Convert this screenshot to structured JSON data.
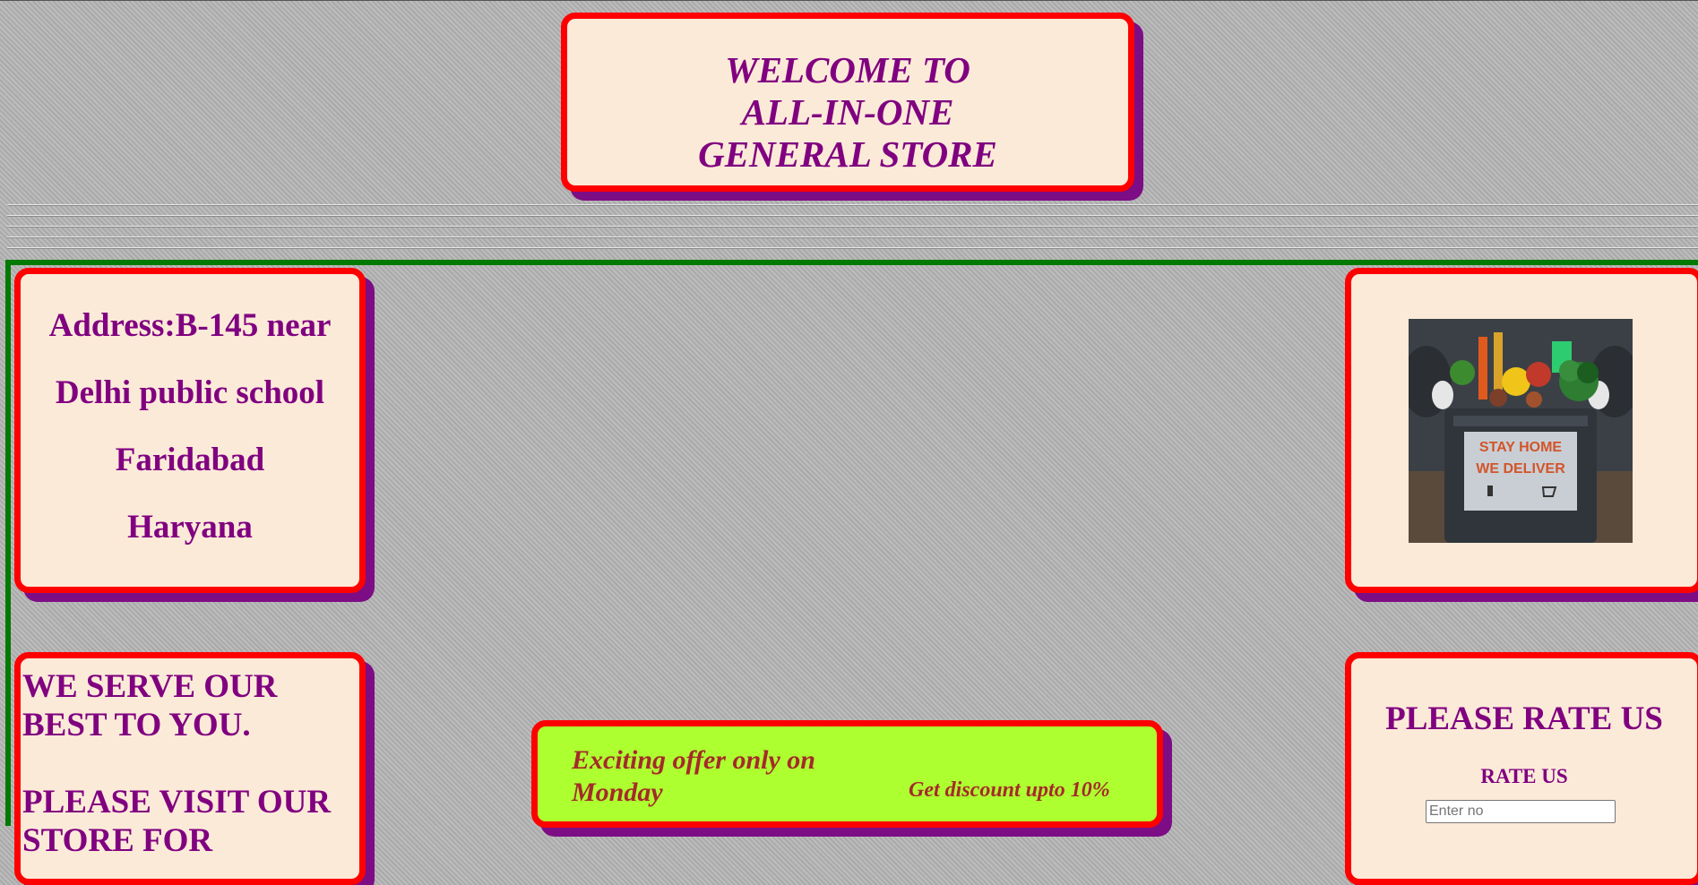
{
  "header": {
    "line1": "WELCOME TO",
    "line2": "ALL-IN-ONE",
    "line3": "GENERAL STORE"
  },
  "address": {
    "line1": "Address:B-145 near",
    "line2": "Delhi public school",
    "line3": "Faridabad",
    "line4": "Haryana"
  },
  "image": {
    "line1": "STAY HOME",
    "line2": "WE DELIVER"
  },
  "serve": {
    "line1": "WE SERVE OUR",
    "line2": "BEST TO YOU.",
    "line3": "PLEASE VISIT OUR",
    "line4": "STORE FOR"
  },
  "offer": {
    "line1": "Exciting offer only on",
    "line2": "Monday",
    "discount": "Get discount upto 10%"
  },
  "rating": {
    "heading": "PLEASE RATE US",
    "label": "RATE US",
    "placeholder": "Enter no"
  },
  "colors": {
    "card_bg": "#fbead8",
    "border": "#ff0000",
    "shadow": "#7d0d85",
    "text": "#800080",
    "offer_bg": "#adff2f",
    "offer_text": "#a52a2a",
    "divider": "#007a00"
  }
}
